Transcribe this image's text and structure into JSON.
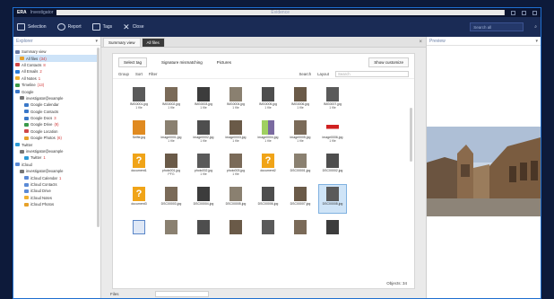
{
  "window": {
    "app": "ERA",
    "subtitle": "Investigator",
    "center": "Evidence"
  },
  "toolbar": {
    "items": [
      "Selection",
      "Report",
      "Tags",
      "Close"
    ],
    "search_placeholder": "Search all"
  },
  "explorer": {
    "title": "Explorer",
    "nodes": [
      {
        "label": "Summary view",
        "count": "",
        "level": 0,
        "color": "#6b7da6",
        "selected": false
      },
      {
        "label": "All files",
        "count": "(34)",
        "level": 1,
        "color": "#e6a12a",
        "selected": true
      },
      {
        "label": "All Contacts",
        "count": "8",
        "level": 0,
        "color": "#d04848",
        "selected": false
      },
      {
        "label": "All Emails",
        "count": "2",
        "level": 0,
        "color": "#2c7dd6",
        "selected": false
      },
      {
        "label": "All Notes",
        "count": "1",
        "level": 0,
        "color": "#f0b030",
        "selected": false
      },
      {
        "label": "Timeline",
        "count": "(13)",
        "level": 0,
        "color": "#3a9a4a",
        "selected": false
      },
      {
        "label": "Google",
        "count": "",
        "level": 0,
        "color": "#3a78c8",
        "selected": false
      },
      {
        "label": "investigator@example",
        "count": "",
        "level": 1,
        "color": "#777777",
        "selected": false
      },
      {
        "label": "Google Calendar",
        "count": "",
        "level": 2,
        "color": "#3a78c8",
        "selected": false
      },
      {
        "label": "Google Contacts",
        "count": "",
        "level": 2,
        "color": "#3a78c8",
        "selected": false
      },
      {
        "label": "Google Docs",
        "count": "3",
        "level": 2,
        "color": "#3a78c8",
        "selected": false
      },
      {
        "label": "Google Drive",
        "count": "(9)",
        "level": 2,
        "color": "#3a9a4a",
        "selected": false
      },
      {
        "label": "Google Location",
        "count": "",
        "level": 2,
        "color": "#d04848",
        "selected": false
      },
      {
        "label": "Google Photos",
        "count": "(6)",
        "level": 2,
        "color": "#e6a12a",
        "selected": false
      },
      {
        "label": "Twitter",
        "count": "",
        "level": 0,
        "color": "#2c9ad6",
        "selected": false
      },
      {
        "label": "investigator@example",
        "count": "",
        "level": 1,
        "color": "#777777",
        "selected": false
      },
      {
        "label": "Twitter",
        "count": "1",
        "level": 2,
        "color": "#2c9ad6",
        "selected": false
      },
      {
        "label": "iCloud",
        "count": "",
        "level": 0,
        "color": "#5a8ad6",
        "selected": false
      },
      {
        "label": "investigator@example",
        "count": "",
        "level": 1,
        "color": "#777777",
        "selected": false
      },
      {
        "label": "iCloud Calendar",
        "count": "1",
        "level": 2,
        "color": "#5a8ad6",
        "selected": false
      },
      {
        "label": "iCloud Contacts",
        "count": "",
        "level": 2,
        "color": "#5a8ad6",
        "selected": false
      },
      {
        "label": "iCloud Drive",
        "count": "",
        "level": 2,
        "color": "#5a8ad6",
        "selected": false
      },
      {
        "label": "iCloud Notes",
        "count": "",
        "level": 2,
        "color": "#f0b030",
        "selected": false
      },
      {
        "label": "iCloud Photos",
        "count": "",
        "level": 2,
        "color": "#e6a12a",
        "selected": false
      }
    ]
  },
  "tabs": [
    "Summary view",
    "All files"
  ],
  "filters": {
    "tag": "Select tag",
    "scan": "Signature mismatching",
    "pictures": "Pictures",
    "customize": "Show customize"
  },
  "options": {
    "group": "Group",
    "sort": "Sort",
    "filter": "Filter",
    "search_label": "Search",
    "layout": "Layout",
    "search_placeholder": "Search"
  },
  "files": [
    {
      "name": "IMG0001.jpg",
      "sub": "1 file",
      "kind": "photo",
      "selected": false
    },
    {
      "name": "IMG0002.jpg",
      "sub": "1 file",
      "kind": "photo",
      "selected": false
    },
    {
      "name": "IMG0003.jpg",
      "sub": "1 file",
      "kind": "photo",
      "selected": false
    },
    {
      "name": "IMG0004.jpg",
      "sub": "1 file",
      "kind": "photo",
      "selected": false
    },
    {
      "name": "IMG0005.jpg",
      "sub": "1 file",
      "kind": "photo",
      "selected": false
    },
    {
      "name": "IMG0006.jpg",
      "sub": "1 file",
      "kind": "photo",
      "selected": false
    },
    {
      "name": "IMG0007.jpg",
      "sub": "1 file",
      "kind": "photo",
      "selected": false
    },
    {
      "name": "",
      "sub": "",
      "kind": "empty",
      "selected": false
    },
    {
      "name": "Selfie.jpg",
      "sub": "",
      "kind": "orange",
      "selected": false
    },
    {
      "name": "image0001.jpg",
      "sub": "1 file",
      "kind": "photo",
      "selected": false
    },
    {
      "name": "image0002.jpg",
      "sub": "1 file",
      "kind": "photo",
      "selected": false
    },
    {
      "name": "image0003.jpg",
      "sub": "1 file",
      "kind": "photo",
      "selected": false
    },
    {
      "name": "image0004.jpg",
      "sub": "1 file",
      "kind": "green",
      "selected": false
    },
    {
      "name": "image0005.jpg",
      "sub": "1 file",
      "kind": "photo",
      "selected": false
    },
    {
      "name": "image0006.jpg",
      "sub": "1 file",
      "kind": "red",
      "selected": false
    },
    {
      "name": "",
      "sub": "",
      "kind": "empty",
      "selected": false
    },
    {
      "name": "document1",
      "sub": "",
      "kind": "unknown",
      "selected": false
    },
    {
      "name": "photo001.jpg",
      "sub": "PFG",
      "kind": "photo",
      "selected": false
    },
    {
      "name": "photo002.jpg",
      "sub": "1 file",
      "kind": "photo",
      "selected": false
    },
    {
      "name": "photo003.jpg",
      "sub": "1 file",
      "kind": "photo",
      "selected": false
    },
    {
      "name": "document2",
      "sub": "",
      "kind": "unknown",
      "selected": false
    },
    {
      "name": "DSC00001.jpg",
      "sub": "",
      "kind": "photo",
      "selected": false
    },
    {
      "name": "DSC00002.jpg",
      "sub": "",
      "kind": "photo",
      "selected": false
    },
    {
      "name": "",
      "sub": "",
      "kind": "empty",
      "selected": false
    },
    {
      "name": "document3",
      "sub": "",
      "kind": "unknown",
      "selected": false
    },
    {
      "name": "DSC00003.jpg",
      "sub": "",
      "kind": "photo",
      "selected": false
    },
    {
      "name": "DSC00004.jpg",
      "sub": "",
      "kind": "photo",
      "selected": false
    },
    {
      "name": "DSC00005.jpg",
      "sub": "",
      "kind": "photo",
      "selected": false
    },
    {
      "name": "DSC00006.jpg",
      "sub": "",
      "kind": "photo",
      "selected": false
    },
    {
      "name": "DSC00007.jpg",
      "sub": "",
      "kind": "photo",
      "selected": false
    },
    {
      "name": "DSC00008.jpg",
      "sub": "",
      "kind": "photo",
      "selected": true
    },
    {
      "name": "",
      "sub": "",
      "kind": "empty",
      "selected": false
    },
    {
      "name": "",
      "sub": "",
      "kind": "file",
      "selected": false
    },
    {
      "name": "",
      "sub": "",
      "kind": "photo",
      "selected": false
    },
    {
      "name": "",
      "sub": "",
      "kind": "photo",
      "selected": false
    },
    {
      "name": "",
      "sub": "",
      "kind": "photo",
      "selected": false
    },
    {
      "name": "",
      "sub": "",
      "kind": "photo",
      "selected": false
    },
    {
      "name": "",
      "sub": "",
      "kind": "photo",
      "selected": false
    },
    {
      "name": "",
      "sub": "",
      "kind": "photo",
      "selected": false
    },
    {
      "name": "",
      "sub": "",
      "kind": "empty",
      "selected": false
    }
  ],
  "status": "Objects: 34",
  "bottom": {
    "label": "Files",
    "value": ""
  },
  "preview": {
    "title": "Preview"
  }
}
